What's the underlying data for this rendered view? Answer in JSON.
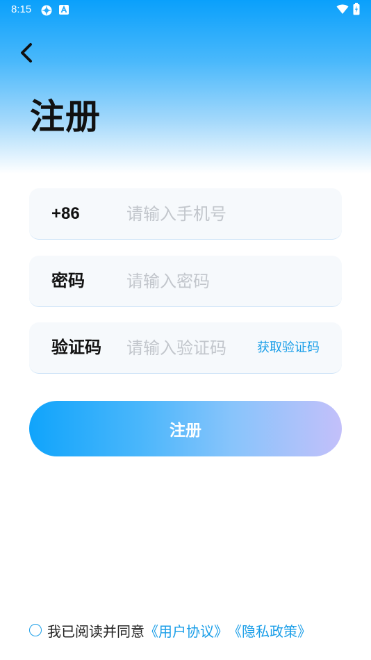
{
  "status_bar": {
    "time": "8:15",
    "icons": [
      "gear-icon",
      "font-icon",
      "wifi-icon",
      "battery-icon"
    ]
  },
  "header": {
    "title": "注册"
  },
  "form": {
    "phone": {
      "prefix": "+86",
      "placeholder": "请输入手机号"
    },
    "password": {
      "label": "密码",
      "placeholder": "请输入密码"
    },
    "code": {
      "label": "验证码",
      "placeholder": "请输入验证码",
      "get_code_label": "获取验证码"
    },
    "submit_label": "注册"
  },
  "agreement": {
    "text": "我已阅读并同意",
    "user_agreement": "《用户协议》",
    "privacy_policy": "《隐私政策》"
  },
  "colors": {
    "accent": "#1a9ee8",
    "gradient_start": "#10a4fb",
    "gradient_end": "#c3c0fa"
  }
}
